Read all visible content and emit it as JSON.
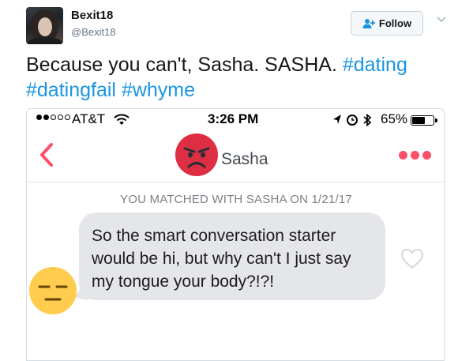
{
  "tweet": {
    "display_name": "Bexit18",
    "handle": "@Bexit18",
    "follow_label": "Follow",
    "text_plain": "Because you can't, Sasha. SASHA.",
    "hashtags": [
      "#dating",
      "#datingfail",
      "#whyme"
    ]
  },
  "phone": {
    "status": {
      "carrier": "AT&T",
      "time": "3:26 PM",
      "battery": "65%",
      "battery_level": 0.65,
      "signal_bars_filled": 2,
      "signal_bars_total": 5
    },
    "chat": {
      "contact_name": "Sasha",
      "match_text": "YOU MATCHED WITH SASHA ON 1/21/17",
      "message": "So the smart conversation starter would be hi, but why can't I just say my tongue your body?!?!"
    }
  },
  "colors": {
    "hashtag": "#1b95e0",
    "accent": "#fd5068",
    "bubble": "#e5e6ea"
  },
  "icons": [
    "follow-person-icon",
    "chevron-down-icon",
    "wifi-icon",
    "location-arrow-icon",
    "alarm-icon",
    "bluetooth-icon",
    "back-chevron-icon",
    "angry-face-emoji",
    "more-dots-icon",
    "expressionless-face-emoji",
    "heart-icon"
  ]
}
